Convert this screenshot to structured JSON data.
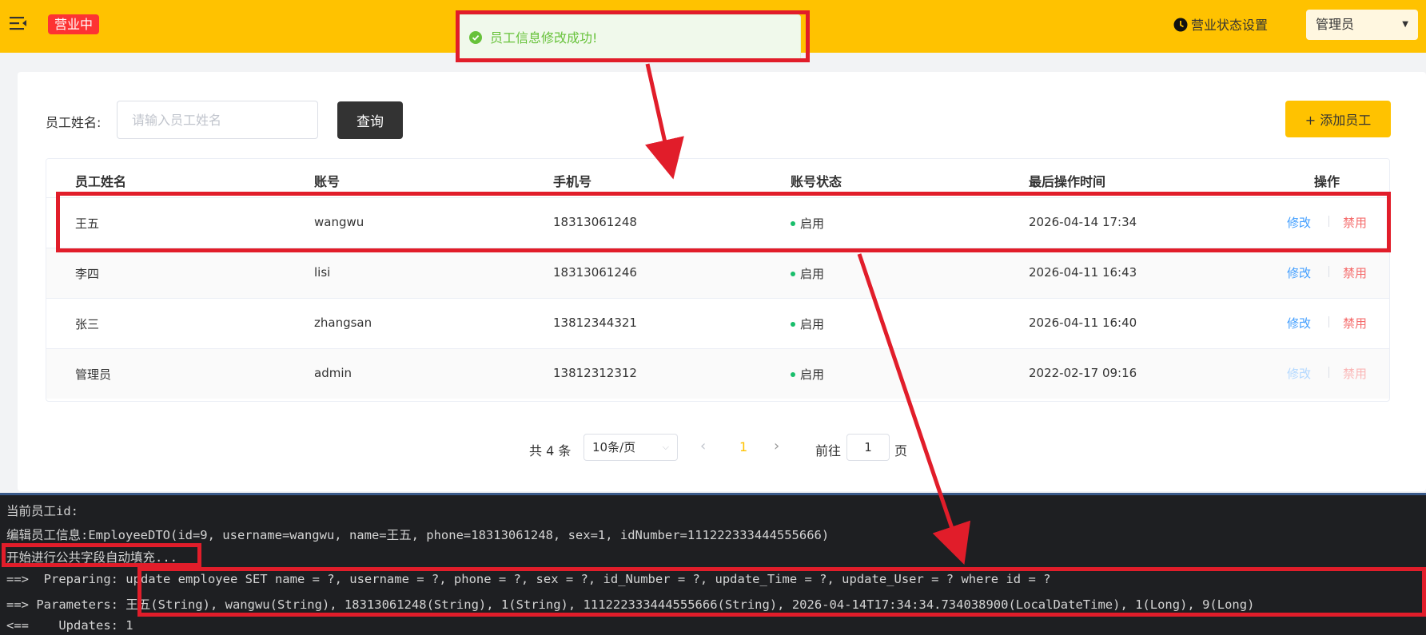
{
  "header": {
    "status_tag": "营业中",
    "shop_status_label": "营业状态设置",
    "user_label": "管理员"
  },
  "toast": {
    "message": "员工信息修改成功!"
  },
  "search": {
    "label": "员工姓名:",
    "placeholder": "请输入员工姓名",
    "query_button": "查询",
    "add_button": "+ 添加员工"
  },
  "table": {
    "columns": [
      "员工姓名",
      "账号",
      "手机号",
      "账号状态",
      "最后操作时间",
      "操作"
    ],
    "rows": [
      {
        "name": "王五",
        "account": "wangwu",
        "phone": "18313061248",
        "status": "启用",
        "time": "2026-04-14 17:34",
        "edit": "修改",
        "disable": "禁用",
        "ops_enabled": true
      },
      {
        "name": "李四",
        "account": "lisi",
        "phone": "18313061246",
        "status": "启用",
        "time": "2026-04-11 16:43",
        "edit": "修改",
        "disable": "禁用",
        "ops_enabled": true
      },
      {
        "name": "张三",
        "account": "zhangsan",
        "phone": "13812344321",
        "status": "启用",
        "time": "2026-04-11 16:40",
        "edit": "修改",
        "disable": "禁用",
        "ops_enabled": true
      },
      {
        "name": "管理员",
        "account": "admin",
        "phone": "13812312312",
        "status": "启用",
        "time": "2022-02-17 09:16",
        "edit": "修改",
        "disable": "禁用",
        "ops_enabled": false
      }
    ]
  },
  "pagination": {
    "total": "共 4 条",
    "page_size": "10条/页",
    "prev": "‹",
    "current_page": "1",
    "next": "›",
    "goto_label": "前往",
    "goto_value": "1",
    "goto_unit": "页"
  },
  "console": {
    "lines": [
      "当前员工id:",
      "编辑员工信息:EmployeeDTO(id=9, username=wangwu, name=王五, phone=18313061248, sex=1, idNumber=111222333444555666)",
      "开始进行公共字段自动填充...",
      "==>  Preparing: update employee SET name = ?, username = ?, phone = ?, sex = ?, id_Number = ?, update_Time = ?, update_User = ? where id = ?",
      "==> Parameters: 王五(String), wangwu(String), 18313061248(String), 1(String), 111222333444555666(String), 2026-04-14T17:34:34.734038900(LocalDateTime), 1(Long), 9(Long)",
      "<==    Updates: 1"
    ]
  },
  "colors": {
    "brand": "#ffc200",
    "status_tag": "#fd3333",
    "success": "#67c23a",
    "link": "#419eff",
    "danger": "#f56c6c",
    "annotation": "#e11d2a"
  },
  "icons": {
    "menu": "menu-fold-icon",
    "toast": "success-check-icon",
    "shop_status": "clock-icon",
    "caret": "caret-down-icon"
  }
}
